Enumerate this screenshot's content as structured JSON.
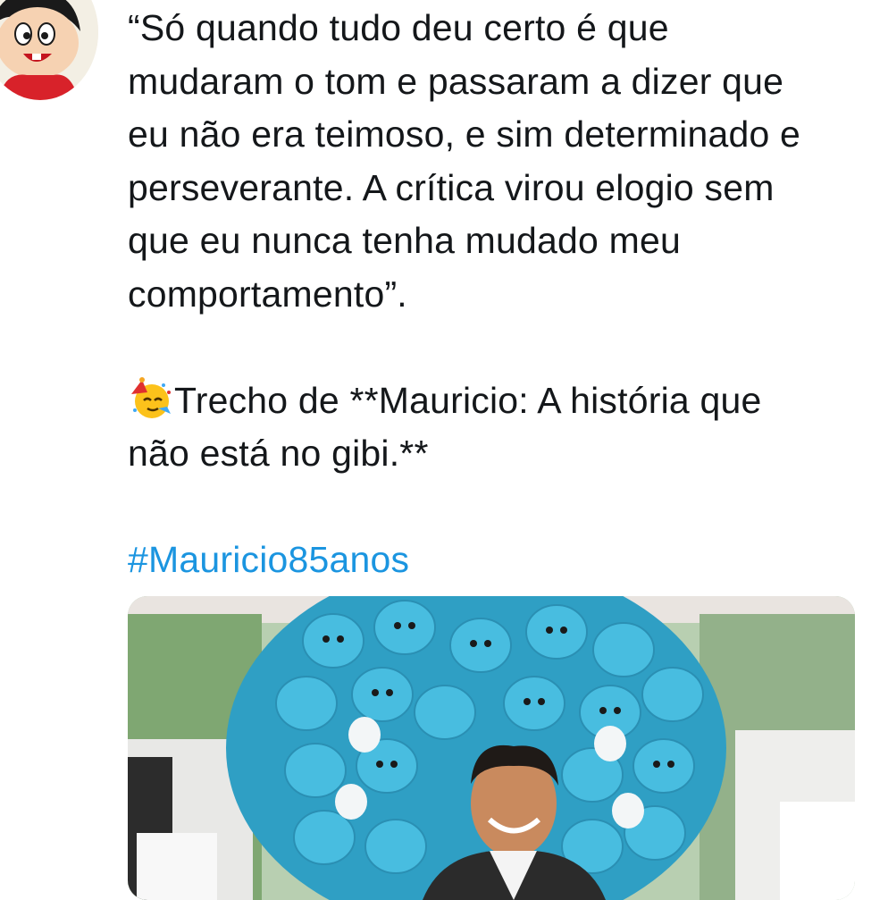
{
  "tweet": {
    "author_avatar_icon": "monica-cartoon-avatar-icon",
    "quote_lines": [
      "“Só quando tudo deu certo é que",
      "mudaram o tom e passaram a dizer que",
      "eu não era teimoso, e sim determinado e",
      "perseverante. A crítica virou elogio sem",
      "que eu nunca tenha mudado meu",
      "comportamento”."
    ],
    "excerpt_emoji": "partying-face-emoji",
    "excerpt_line_1": "Trecho de **Mauricio: A história que",
    "excerpt_line_2": "não está no gibi.**",
    "hashtag": "#Mauricio85anos",
    "media": {
      "description_icon": "photo-man-with-blue-plush-rabbits"
    }
  },
  "colors": {
    "text": "#14171a",
    "link": "#1b95e0",
    "background": "#ffffff",
    "plush_blue": "#3fb5d8"
  }
}
